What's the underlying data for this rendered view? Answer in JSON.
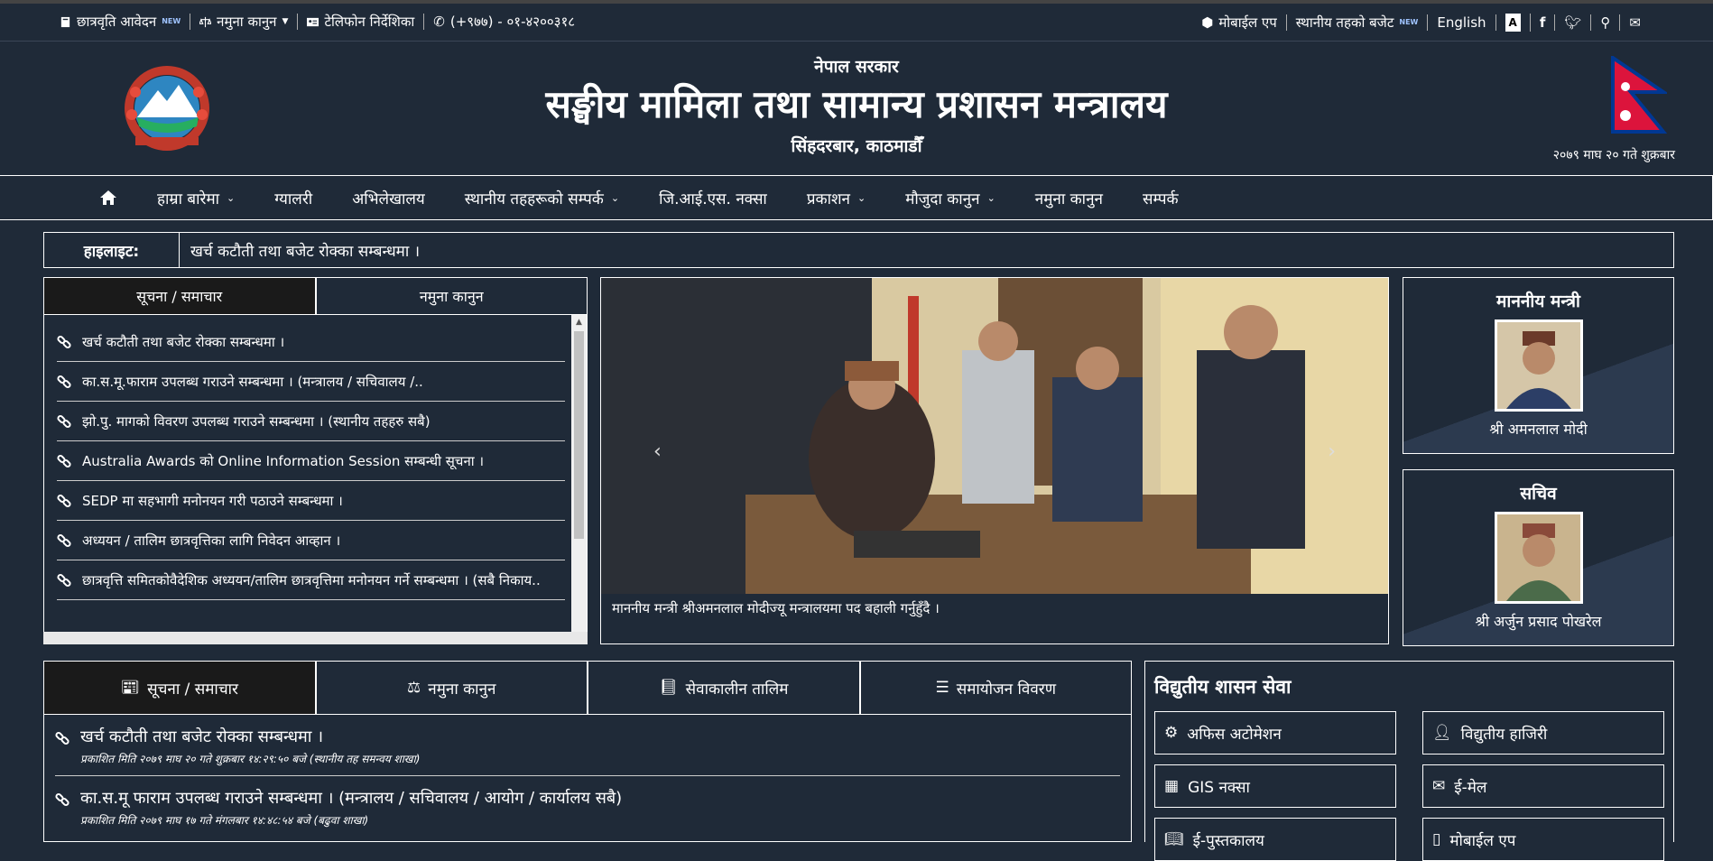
{
  "topbar": {
    "scholarship": "छात्रवृति आवेदन",
    "new_badge": "NEW",
    "model_law": "नमुना कानुन",
    "phone_dir": "टेलिफोन निर्देशिका",
    "phone": "(+९७७) - ०१-४२००३१८",
    "mobile_app": "मोबाईल एप",
    "local_budget": "स्थानीय तहको बजेट",
    "english": "English",
    "font_btn": "A"
  },
  "header": {
    "gov": "नेपाल सरकार",
    "ministry": "सङ्घीय मामिला तथा सामान्य प्रशासन मन्त्रालय",
    "location": "सिंहदरबार, काठमाडौँ",
    "date": "२०७९ माघ २० गते शुक्रबार"
  },
  "nav": {
    "items": [
      {
        "label": "हाम्रा बारेमा",
        "dropdown": true
      },
      {
        "label": "ग्यालरी",
        "dropdown": false
      },
      {
        "label": "अभिलेखालय",
        "dropdown": false
      },
      {
        "label": "स्थानीय तहहरूको सम्पर्क",
        "dropdown": true
      },
      {
        "label": "जि.आई.एस. नक्सा",
        "dropdown": false
      },
      {
        "label": "प्रकाशन",
        "dropdown": true
      },
      {
        "label": "मौजुदा कानुन",
        "dropdown": true
      },
      {
        "label": "नमुना कानुन",
        "dropdown": false
      },
      {
        "label": "सम्पर्क",
        "dropdown": false
      }
    ]
  },
  "highlight": {
    "label": "हाइलाइट:",
    "text": "खर्च कटौती तथा बजेट रोक्का सम्बन्धमा ।"
  },
  "panel1": {
    "tabs": [
      "सूचना / समाचार",
      "नमुना कानुन"
    ],
    "items": [
      "खर्च कटौती तथा बजेट रोक्का सम्बन्धमा ।",
      "का.स.मू.फाराम उपलब्ध गराउने सम्बन्धमा । (मन्त्रालय / सचिवालय /..",
      "झो.पु. मागको विवरण उपलब्ध गराउने सम्बन्धमा । (स्थानीय तहहरु सबै)",
      "Australia Awards को Online Information Session सम्बन्धी सूचना ।",
      "SEDP मा सहभागी मनोनयन गरी पठाउने सम्बन्धमा ।",
      "अध्ययन / तालिम छात्रवृत्तिका लागि निवेदन आव्हान ।",
      "छात्रवृत्ति समितकोवैदेशिक अध्ययन/तालिम छात्रवृत्तिमा मनोनयन गर्ने सम्बन्धमा । (सबै निकाय.."
    ]
  },
  "photo": {
    "caption": "माननीय मन्त्री श्रीअमनलाल मोदीज्यू मन्त्रालयमा पद बहाली गर्नुहुँदै ।"
  },
  "minister": {
    "title": "माननीय मन्त्री",
    "name": "श्री अमनलाल मोदी"
  },
  "secretary": {
    "title": "सचिव",
    "name": "श्री अर्जुन प्रसाद पोखरेल"
  },
  "panel2": {
    "tabs": [
      "सूचना / समाचार",
      "नमुना कानुन",
      "सेवाकालीन तालिम",
      "समायोजन विवरण"
    ],
    "items": [
      {
        "title": "खर्च कटौती तथा बजेट रोक्का सम्बन्धमा ।",
        "meta": "प्रकाशित मिति २०७९ माघ २० गते शुक्रबार १४:२९:५० बजे (स्थानीय तह समन्वय शाखा)"
      },
      {
        "title": "का.स.मू फाराम उपलब्ध गराउने सम्बन्धमा । (मन्त्रालय / सचिवालय / आयोग / कार्यालय सबै)",
        "meta": "प्रकाशित मिति २०७९ माघ १७ गते मंगलबार १४:४८:५४ बजे (बढुवा शाखा)"
      }
    ]
  },
  "egov": {
    "title": "विद्युतीय शासन सेवा",
    "buttons": [
      "अफिस अटोमेशन",
      "विद्युतीय हाजिरी",
      "GIS नक्सा",
      "ई-मेल",
      "ई-पुस्तकालय",
      "मोबाईल एप"
    ]
  }
}
